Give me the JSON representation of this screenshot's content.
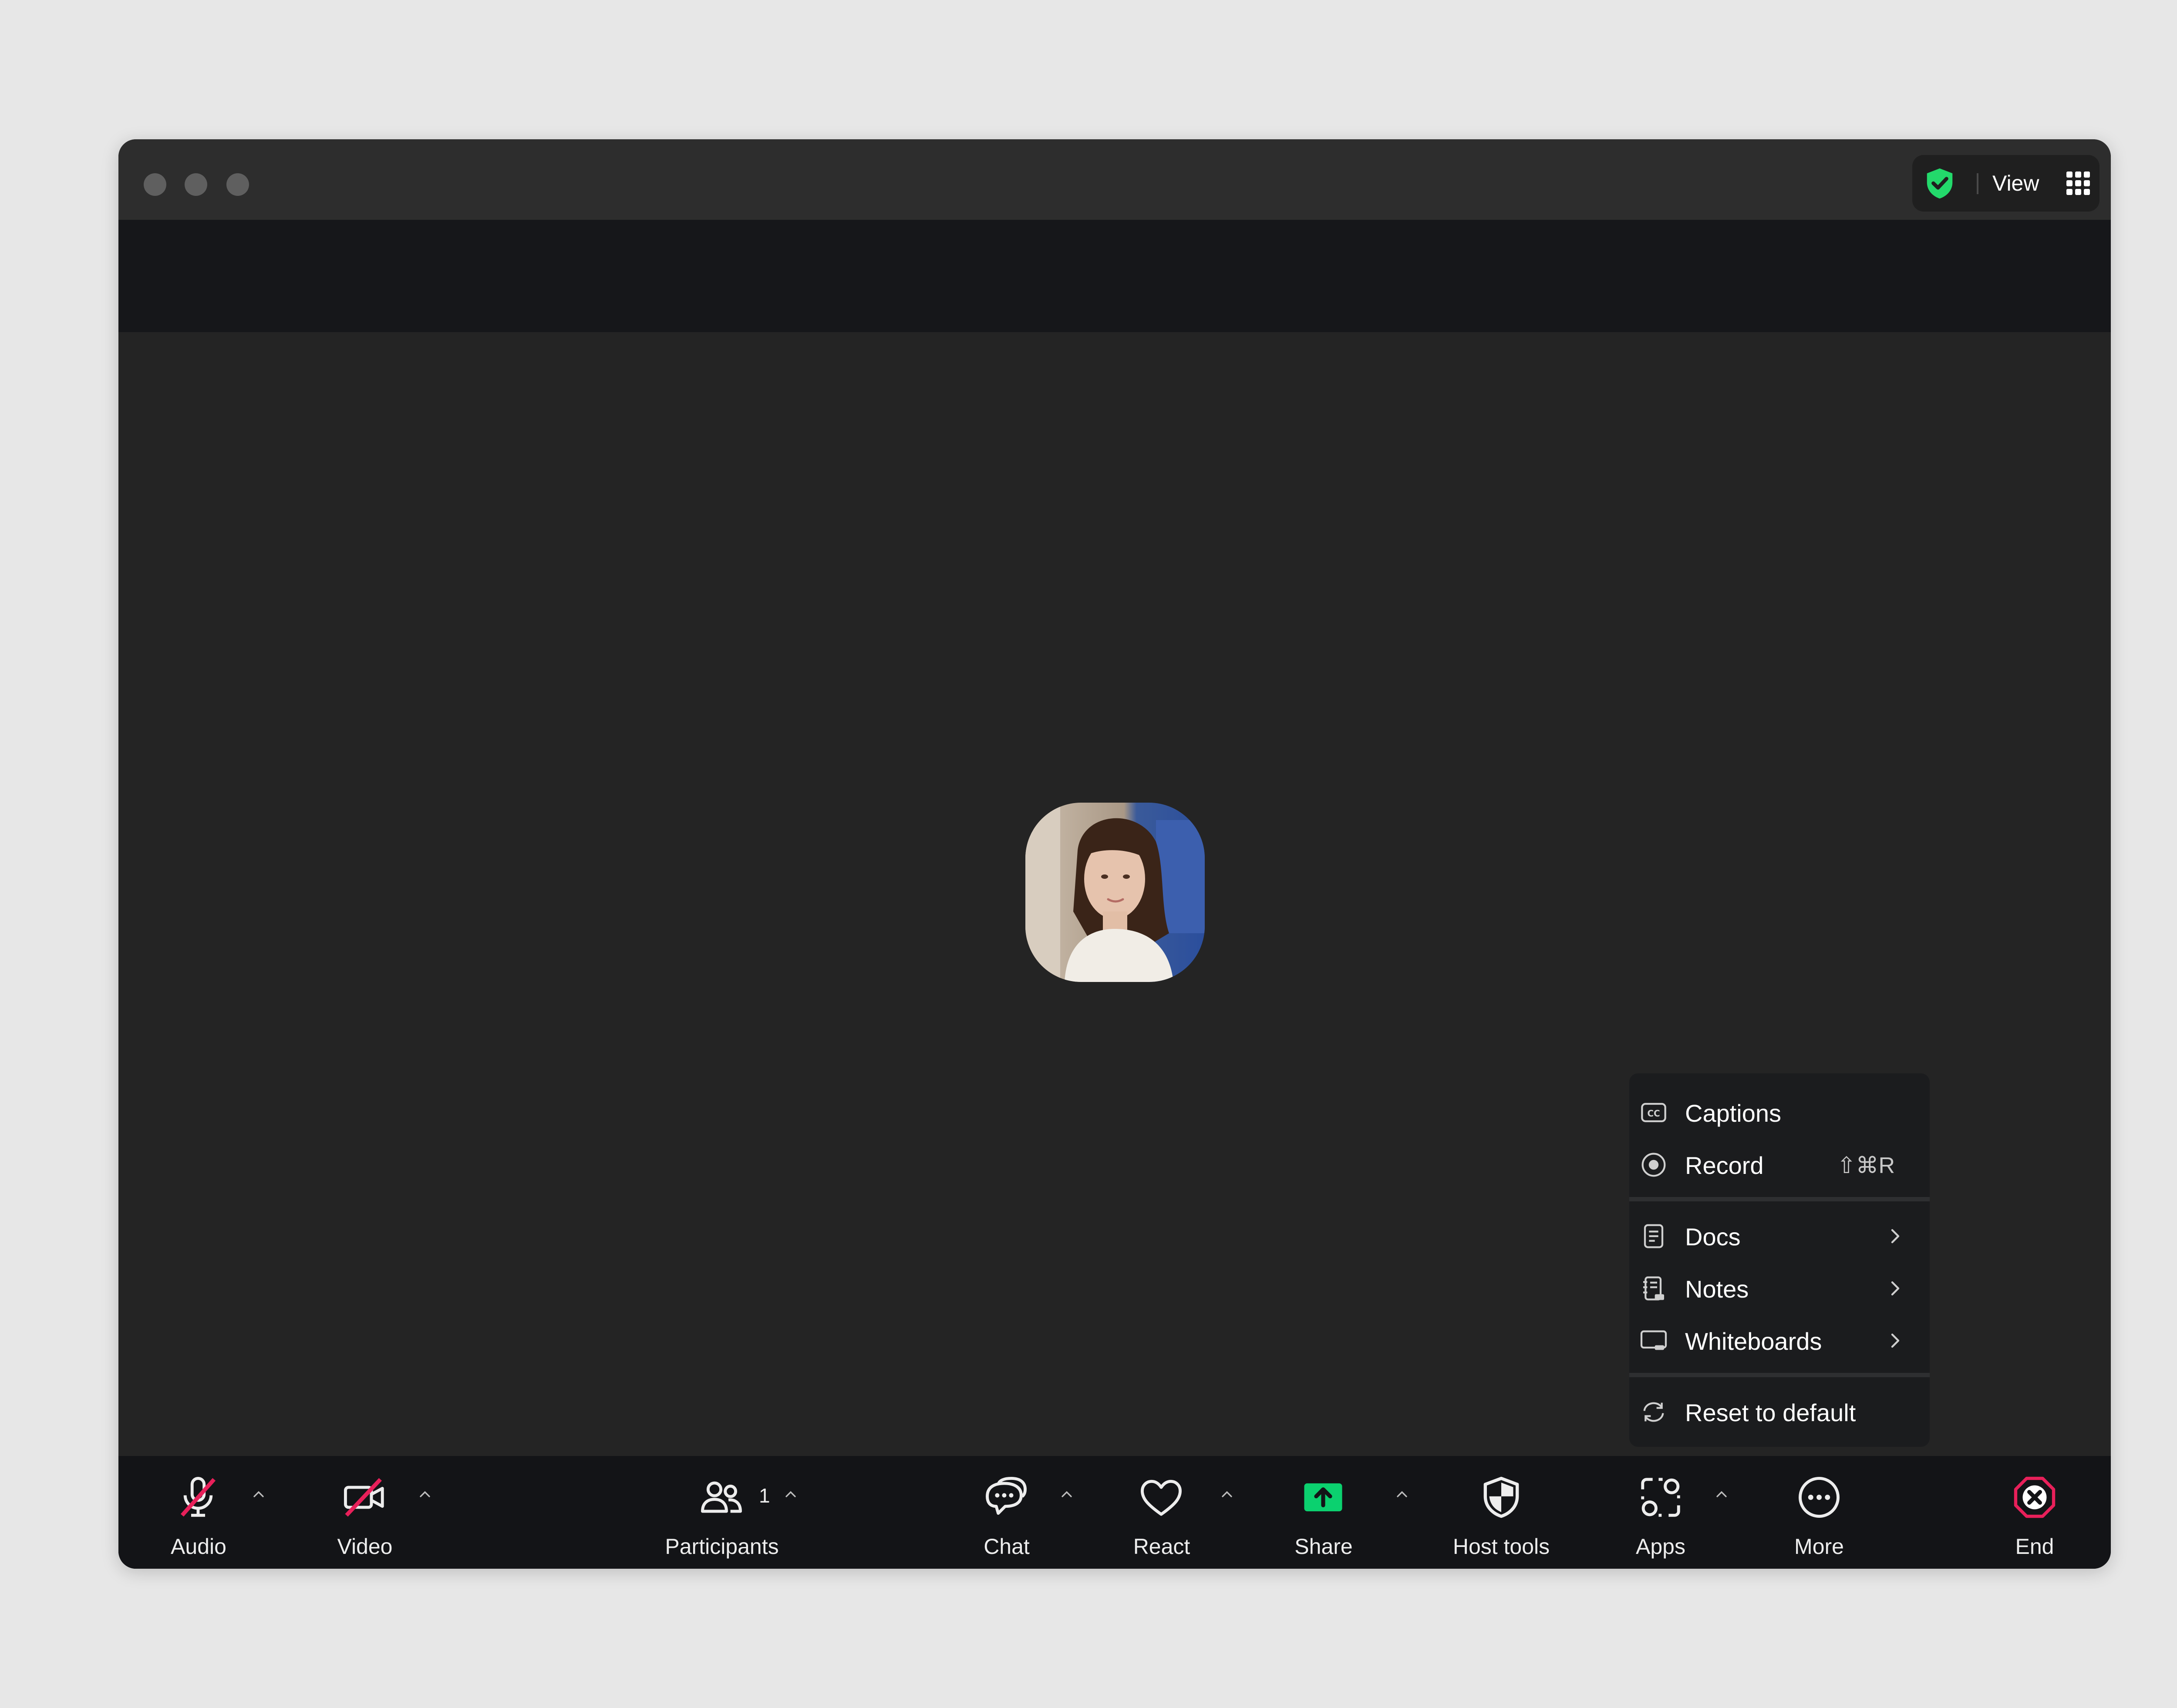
{
  "titlebar": {
    "view_label": "View",
    "security_icon": "shield-check-icon",
    "security_color": "#23d96b"
  },
  "participant": {
    "avatar": "participant-photo"
  },
  "more_menu": {
    "items": [
      {
        "label": "Captions",
        "icon": "cc-icon"
      },
      {
        "label": "Record",
        "icon": "record-icon",
        "shortcut": "⇧⌘R"
      },
      {
        "label": "Docs",
        "icon": "docs-icon"
      },
      {
        "label": "Notes",
        "icon": "notes-icon"
      },
      {
        "label": "Whiteboards",
        "icon": "whiteboard-icon"
      },
      {
        "label": "Reset to default",
        "icon": "reset-icon"
      }
    ]
  },
  "toolbar": {
    "audio": "Audio",
    "video": "Video",
    "participants": "Participants",
    "participants_count": "1",
    "chat": "Chat",
    "react": "React",
    "share": "Share",
    "host_tools": "Host tools",
    "apps": "Apps",
    "more": "More",
    "end": "End"
  },
  "colors": {
    "share_green": "#0bd16f",
    "end_red": "#e8205a",
    "muted_red": "#e8205a"
  }
}
